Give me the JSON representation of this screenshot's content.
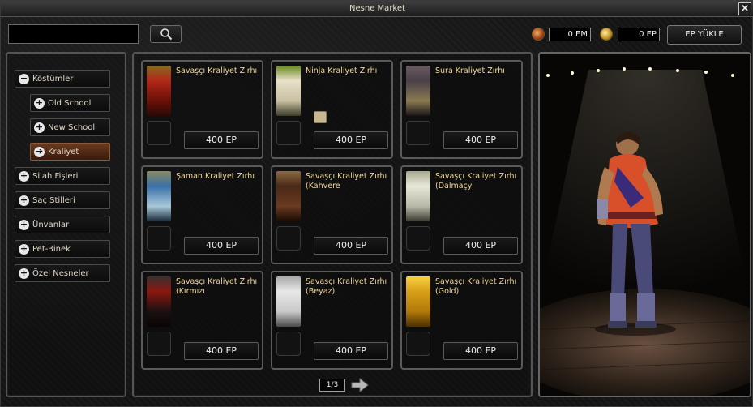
{
  "window": {
    "title": "Nesne Market"
  },
  "search": {
    "value": "",
    "placeholder": ""
  },
  "currency": {
    "em_balance": "0 EM",
    "ep_balance": "0 EP",
    "ep_load_label": "EP YÜKLE"
  },
  "categories": [
    {
      "label": "Köstümler",
      "icon": "minus-icon",
      "expanded": true
    },
    {
      "label": "Old School",
      "icon": "plus-icon",
      "sub": true
    },
    {
      "label": "New School",
      "icon": "plus-icon",
      "sub": true
    },
    {
      "label": "Kraliyet",
      "icon": "arrow-right-icon",
      "sub": true,
      "active": true
    },
    {
      "label": "Silah Fişleri",
      "icon": "plus-icon"
    },
    {
      "label": "Saç Stilleri",
      "icon": "plus-icon"
    },
    {
      "label": "Ünvanlar",
      "icon": "plus-icon"
    },
    {
      "label": "Pet-Binek",
      "icon": "plus-icon"
    },
    {
      "label": "Özel Nesneler",
      "icon": "plus-icon"
    }
  ],
  "items": [
    {
      "name": "Savaşçı Kraliyet Zırhı",
      "price": "400 EP",
      "color": "#b02818"
    },
    {
      "name": "Ninja Kraliyet Zırhı",
      "price": "400 EP",
      "color": "#e8e0c8"
    },
    {
      "name": "Sura Kraliyet Zırhı",
      "price": "400 EP",
      "color": "#4a4048"
    },
    {
      "name": "Şaman Kraliyet Zırhı",
      "price": "400 EP",
      "color": "#3a70a8"
    },
    {
      "name": "Savaşçı Kraliyet Zırhı (Kahvere",
      "price": "400 EP",
      "color": "#4a2818"
    },
    {
      "name": "Savaşçı Kraliyet Zırhı (Dalmaçy",
      "price": "400 EP",
      "color": "#c8c8b8"
    },
    {
      "name": "Savaşçı Kraliyet Zırhı (Kırmızı",
      "price": "400 EP",
      "color": "#8a1810"
    },
    {
      "name": "Savaşçı Kraliyet Zırhı (Beyaz)",
      "price": "400 EP",
      "color": "#d8d8d8"
    },
    {
      "name": "Savaşçı Kraliyet Zırhı (Gold)",
      "price": "400 EP",
      "color": "#d8a018"
    }
  ],
  "pagination": {
    "label": "1/3"
  }
}
